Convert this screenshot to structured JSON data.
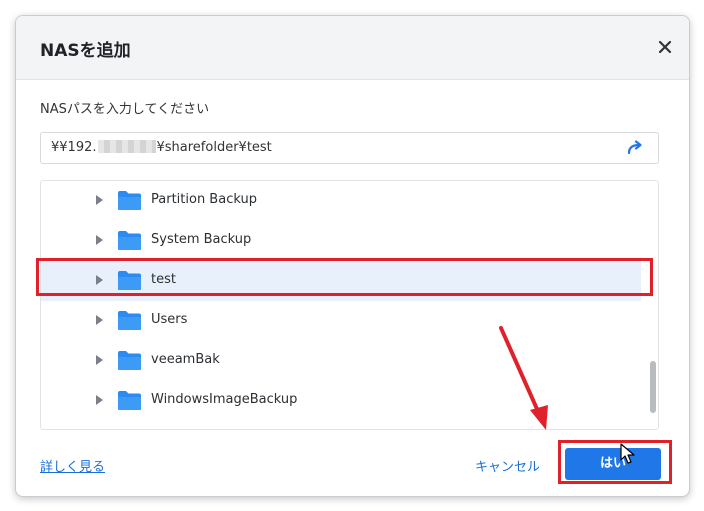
{
  "dialog": {
    "title": "NASを追加",
    "close_icon": "close-icon"
  },
  "path_section": {
    "label": "NASパスを入力してください",
    "value_prefix": "¥¥192.",
    "value_suffix": "¥sharefolder¥test",
    "go_icon": "return-arrow-icon"
  },
  "tree": {
    "items": [
      {
        "label": "Partition Backup",
        "selected": false
      },
      {
        "label": "System Backup",
        "selected": false
      },
      {
        "label": "test",
        "selected": true
      },
      {
        "label": "Users",
        "selected": false
      },
      {
        "label": "veeamBak",
        "selected": false
      },
      {
        "label": "WindowsImageBackup",
        "selected": false
      }
    ]
  },
  "footer": {
    "more_link": "詳しく見る",
    "cancel_label": "キャンセル",
    "ok_label": "はい"
  },
  "colors": {
    "accent": "#1f77e8",
    "link": "#1a6fd6",
    "annotation_red": "#e0202a",
    "selected_row": "#e8f1fb",
    "folder": "#2a8bf2"
  }
}
